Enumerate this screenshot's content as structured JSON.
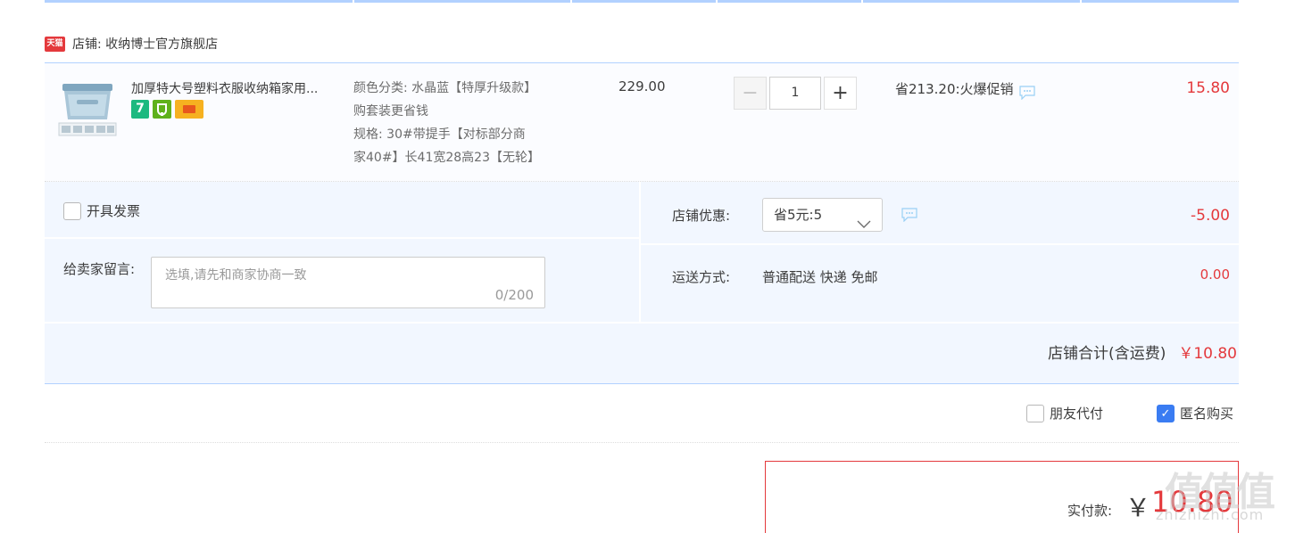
{
  "shop": {
    "badge_text": "天猫",
    "label": "店铺: 收纳博士官方旗舰店"
  },
  "item": {
    "title": "加厚特大号塑料衣服收纳箱家用...",
    "badge_seven": "7",
    "sku_lines": [
      "颜色分类: 水晶蓝【特厚升级款】",
      "购套装更省钱",
      "规格: 30#带提手【对标部分商",
      "家40#】长41宽28高23【无轮】"
    ],
    "unit_price": "229.00",
    "quantity": "1",
    "minus": "−",
    "plus": "+",
    "promo": "省213.20:火爆促销",
    "total": "15.80"
  },
  "options": {
    "invoice_label": "开具发票",
    "message_label": "给卖家留言:",
    "message_placeholder": "选填,请先和商家协商一致",
    "message_count": "0/200",
    "coupon_label": "店铺优惠:",
    "coupon_value": "省5元:5",
    "coupon_amount": "-5.00",
    "shipping_label": "运送方式:",
    "shipping_value": "普通配送 快递 免邮",
    "shipping_amount": "0.00",
    "shop_total_label": "店铺合计(含运费)",
    "shop_total_amount": "￥10.80"
  },
  "extra": {
    "friend_pay_label": "朋友代付",
    "friend_pay_checked": false,
    "anonymous_label": "匿名购买",
    "anonymous_checked": true
  },
  "payment": {
    "label": "实付款:",
    "currency": "￥",
    "amount": "10.80"
  },
  "watermark": {
    "logo": "值值值",
    "url": "zhizhizhi.com"
  },
  "colors": {
    "accent_red": "#e4393c",
    "accent_blue": "#b2d1ff",
    "panel_bg": "#f2f7ff",
    "checkbox_blue": "#3a7cf2"
  }
}
